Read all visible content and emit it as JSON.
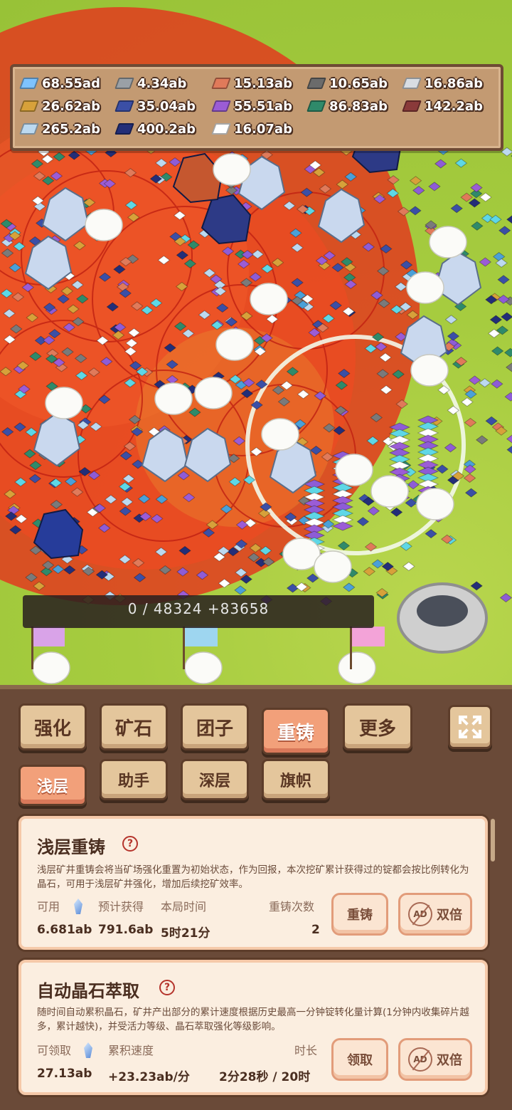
{
  "resources": [
    {
      "value": "68.55ad",
      "color": "#7ec3ff",
      "icon": "diamond-gem-icon"
    },
    {
      "value": "4.34ab",
      "color": "#9aa0a6",
      "icon": "silver-ingot-icon"
    },
    {
      "value": "15.13ab",
      "color": "#e07a5a",
      "icon": "copper-ingot-icon"
    },
    {
      "value": "10.65ab",
      "color": "#6b6b6b",
      "icon": "iron-ingot-icon"
    },
    {
      "value": "16.86ab",
      "color": "#d8dde3",
      "icon": "platinum-ingot-icon"
    },
    {
      "value": "26.62ab",
      "color": "#d7a13a",
      "icon": "gold-ingot-icon"
    },
    {
      "value": "35.04ab",
      "color": "#3b4fa6",
      "icon": "sapphire-ingot-icon"
    },
    {
      "value": "55.51ab",
      "color": "#9b5cd6",
      "icon": "amethyst-ingot-icon"
    },
    {
      "value": "86.83ab",
      "color": "#2f8a6a",
      "icon": "emerald-ingot-icon"
    },
    {
      "value": "142.2ab",
      "color": "#8a3a3a",
      "icon": "ruby-ingot-icon"
    },
    {
      "value": "265.2ab",
      "color": "#bcd9f0",
      "icon": "crystal-ingot-icon"
    },
    {
      "value": "400.2ab",
      "color": "#232e78",
      "icon": "lapis-ingot-icon"
    },
    {
      "value": "16.07ab",
      "color": "#ffffff",
      "icon": "white-ingot-icon"
    }
  ],
  "progress_text": "0 / 48324 +83658",
  "tabs": {
    "main": [
      "强化",
      "矿石",
      "团子",
      "重铸",
      "更多"
    ],
    "active_main": "重铸",
    "sub": [
      "浅层",
      "助手",
      "深层",
      "旗帜"
    ],
    "active_sub": "浅层"
  },
  "reforge": {
    "title": "浅层重铸",
    "help": "?",
    "description": "浅层矿井重铸会将当矿场强化重置为初始状态，作为回报，本次挖矿累计获得过的锭都会按比例转化为晶石，可用于浅层矿井强化，增加后续挖矿效率。",
    "labels": {
      "available": "可用",
      "expected": "预计获得",
      "time": "本局时间",
      "count": "重铸次数"
    },
    "values": {
      "available": "6.681ab",
      "expected": "791.6ab",
      "time": "5时21分",
      "count": "2"
    },
    "button": "重铸",
    "double": "双倍",
    "ad": "AD"
  },
  "auto_extract": {
    "title": "自动晶石萃取",
    "help": "?",
    "description": "随时间自动累积晶石，矿井产出部分的累计速度根据历史最高一分钟锭转化量计算(1分钟内收集碎片越多，累计越快)，并受活力等级、晶石萃取强化等级影响。",
    "labels": {
      "claimable": "可领取",
      "rate": "累积速度",
      "duration": "时长"
    },
    "values": {
      "claimable": "27.13ab",
      "rate": "+23.23ab/分",
      "duration": "2分28秒 / 20时"
    },
    "button": "领取",
    "double": "双倍",
    "ad": "AD"
  }
}
